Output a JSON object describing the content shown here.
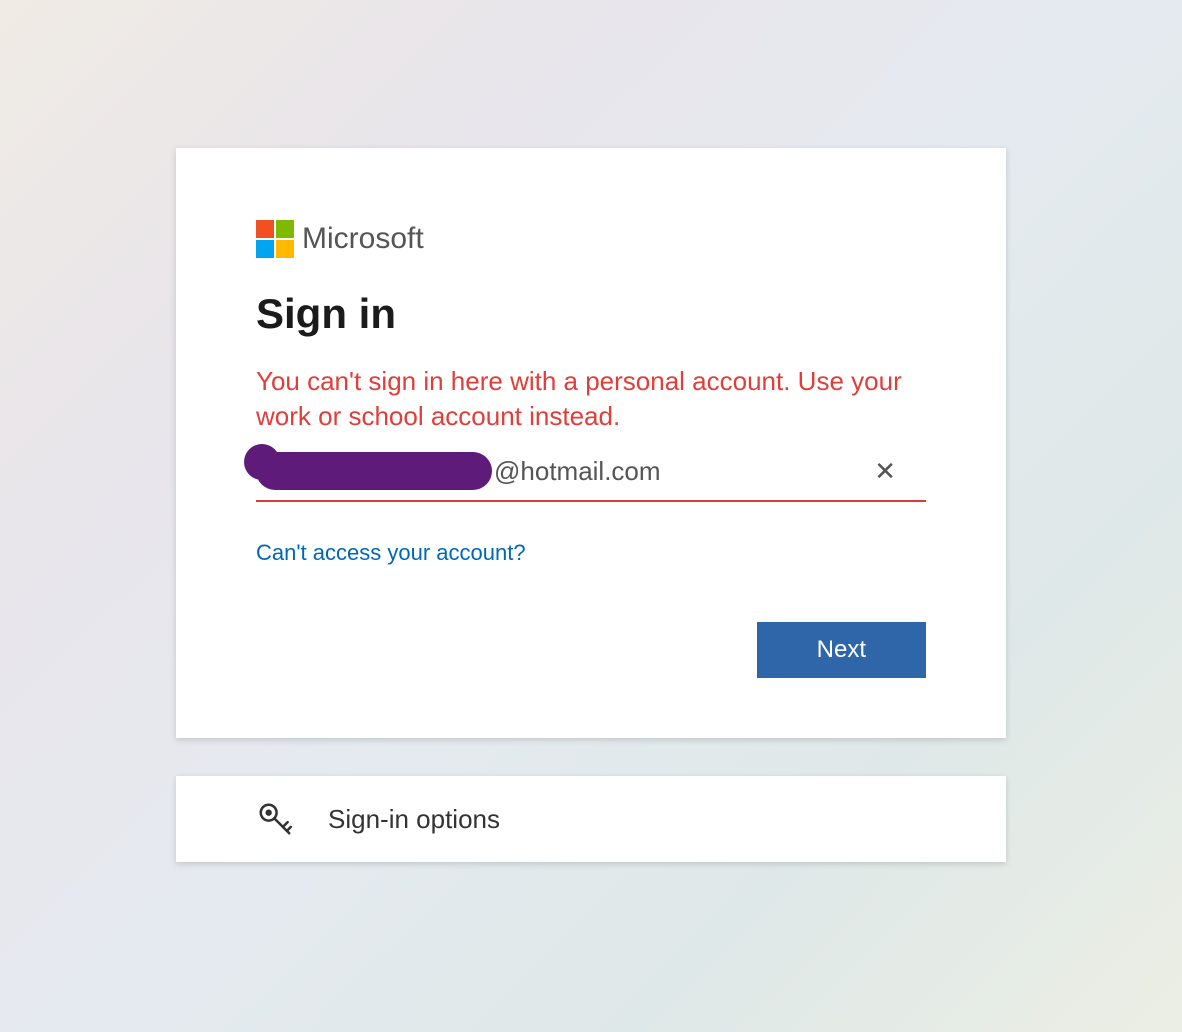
{
  "brand": {
    "name": "Microsoft"
  },
  "signin": {
    "title": "Sign in",
    "error_message": "You can't sign in here with a personal account. Use your work or school account instead.",
    "email_value": "@hotmail.com",
    "access_link": "Can't access your account?",
    "next_button": "Next"
  },
  "options": {
    "label": "Sign-in options"
  },
  "colors": {
    "error": "#e13e3a",
    "link": "#0067b8",
    "primary_button": "#2f65a9",
    "redaction": "#5e1b7a"
  }
}
